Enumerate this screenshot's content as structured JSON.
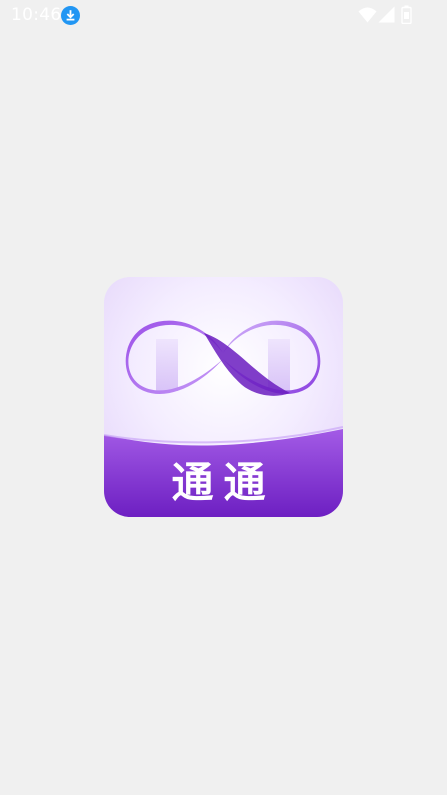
{
  "status_bar": {
    "time": "10:46",
    "icons": [
      "download-icon",
      "wifi-icon",
      "signal-icon",
      "battery-icon"
    ]
  },
  "splash": {
    "logo_text": "通通",
    "logo_icon": "infinity-icon"
  },
  "colors": {
    "background": "#f0f0f0",
    "accent": "#b36cf0",
    "accent_dark": "#7c2fc9",
    "download_badge": "#2196f3"
  }
}
